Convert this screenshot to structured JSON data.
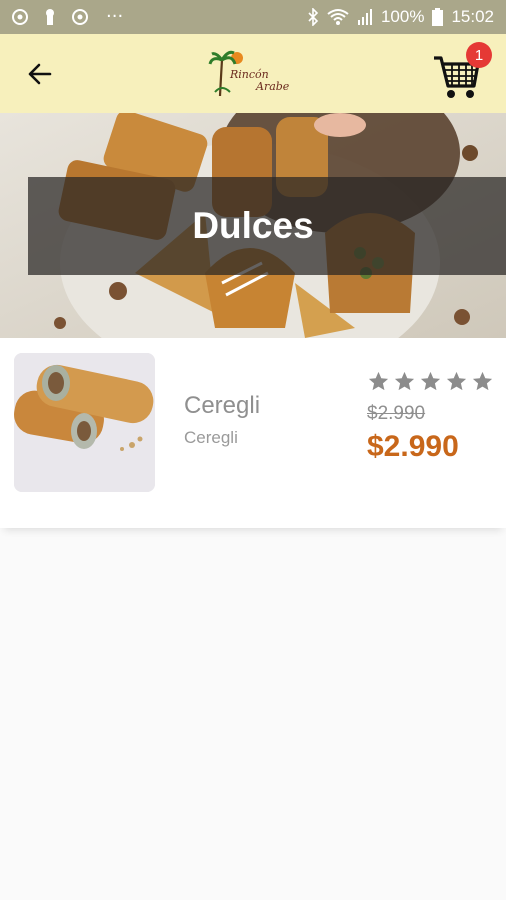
{
  "status_bar": {
    "battery": "100%",
    "time": "15:02",
    "more": "···"
  },
  "app_bar": {
    "logo_text": "Rincón Arabe",
    "cart_count": "1"
  },
  "hero": {
    "title": "Dulces"
  },
  "product": {
    "name": "Ceregli",
    "description": "Ceregli",
    "old_price": "$2.990",
    "price": "$2.990",
    "rating": 0,
    "stars_total": 5
  },
  "colors": {
    "status_bar": "#aaa78a",
    "app_bar": "#f7f0bc",
    "price": "#c8671a",
    "badge": "#e53935"
  }
}
